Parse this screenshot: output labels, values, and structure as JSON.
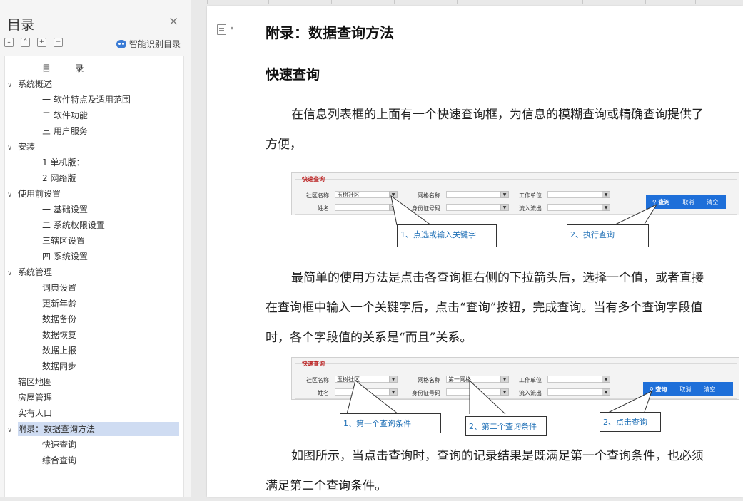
{
  "sidebar": {
    "title": "目录",
    "close_glyph": "×",
    "tools": [
      "⌄",
      "⌃",
      "+",
      "−"
    ],
    "smart_label": "智能识别目录",
    "items": [
      {
        "label": "目         录",
        "level": 1,
        "chev": ""
      },
      {
        "label": "系统概述",
        "level": 0,
        "chev": "∨"
      },
      {
        "label": "一 软件特点及适用范围",
        "level": 1,
        "chev": ""
      },
      {
        "label": "二 软件功能",
        "level": 1,
        "chev": ""
      },
      {
        "label": "三 用户服务",
        "level": 1,
        "chev": ""
      },
      {
        "label": "安装",
        "level": 0,
        "chev": "∨"
      },
      {
        "label": "1 单机版：",
        "level": 1,
        "chev": ""
      },
      {
        "label": "2 网络版",
        "level": 1,
        "chev": ""
      },
      {
        "label": "使用前设置",
        "level": 0,
        "chev": "∨"
      },
      {
        "label": "一 基础设置",
        "level": 1,
        "chev": ""
      },
      {
        "label": "二 系统权限设置",
        "level": 1,
        "chev": ""
      },
      {
        "label": "三辖区设置",
        "level": 1,
        "chev": ""
      },
      {
        "label": "四 系统设置",
        "level": 1,
        "chev": ""
      },
      {
        "label": "系统管理",
        "level": 0,
        "chev": "∨"
      },
      {
        "label": "词典设置",
        "level": 1,
        "chev": ""
      },
      {
        "label": "更新年龄",
        "level": 1,
        "chev": ""
      },
      {
        "label": "数据备份",
        "level": 1,
        "chev": ""
      },
      {
        "label": "数据恢复",
        "level": 1,
        "chev": ""
      },
      {
        "label": "数据上报",
        "level": 1,
        "chev": ""
      },
      {
        "label": "数据同步",
        "level": 1,
        "chev": ""
      },
      {
        "label": "辖区地图",
        "level": 0,
        "chev": ""
      },
      {
        "label": "房屋管理",
        "level": 0,
        "chev": ""
      },
      {
        "label": "实有人口",
        "level": 0,
        "chev": ""
      },
      {
        "label": "附录：数据查询方法",
        "level": 0,
        "chev": "∨",
        "selected": true
      },
      {
        "label": "快速查询",
        "level": 1,
        "chev": ""
      },
      {
        "label": "综合查询",
        "level": 1,
        "chev": ""
      }
    ]
  },
  "document": {
    "heading1": "附录：数据查询方法",
    "heading2": "快速查询",
    "para1": "在信息列表框的上面有一个快速查询框，为信息的模糊查询或精确查询提供了方便，",
    "para2": "最简单的使用方法是点击各查询框右侧的下拉箭头后，选择一个值，或者直接在查询框中输入一个关键字后，点击“查询”按钮，完成查询。当有多个查询字段值时，各个字段值的关系是“而且”关系。",
    "para3": "如图所示，当点击查询时，查询的记录结果是既满足第一个查询条件，也必须满足第二个查询条件。"
  },
  "figure1": {
    "legend": "快速查询",
    "fields": {
      "community_label": "社区名称",
      "community_value": "玉树社区",
      "grid_label": "网格名称",
      "grid_value": "",
      "work_label": "工作单位",
      "name_label": "姓名",
      "id_label": "身份证号码",
      "flow_label": "流入流出"
    },
    "buttons": {
      "query": "查询",
      "cancel": "取消",
      "clear": "清空"
    },
    "callouts": {
      "c1": "1、点选或输入关键字",
      "c2": "2、执行查询"
    }
  },
  "figure2": {
    "legend": "快速查询",
    "fields": {
      "community_label": "社区名称",
      "community_value": "玉树社区",
      "grid_label": "网格名称",
      "grid_value": "第一网格",
      "work_label": "工作单位",
      "name_label": "姓名",
      "id_label": "身份证号码",
      "flow_label": "流入流出"
    },
    "buttons": {
      "query": "查询",
      "cancel": "取消",
      "clear": "清空"
    },
    "callouts": {
      "c1": "1、第一个查询条件",
      "c2": "2、第二个查询条件",
      "c3": "2、点击查询"
    }
  }
}
